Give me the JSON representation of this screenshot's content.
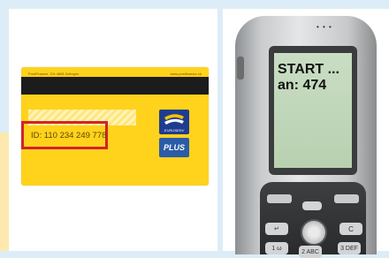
{
  "card": {
    "header_left": "PostFinance, CH-4808 Zofingen",
    "header_right": "www.postfinance.ch",
    "id_text": "ID: 110 234 249 778",
    "eurocard_label": "EUROSERV",
    "plus_label": "PLUS",
    "highlight_color": "#d1232a",
    "card_color": "#ffd21c"
  },
  "phone": {
    "screen_lines": [
      "START ...",
      "an: 474"
    ],
    "speaker": "• • •",
    "keys": {
      "back": "↵",
      "clear": "C",
      "one": "1 ω",
      "two": "2 ABC",
      "three": "3 DEF"
    }
  }
}
